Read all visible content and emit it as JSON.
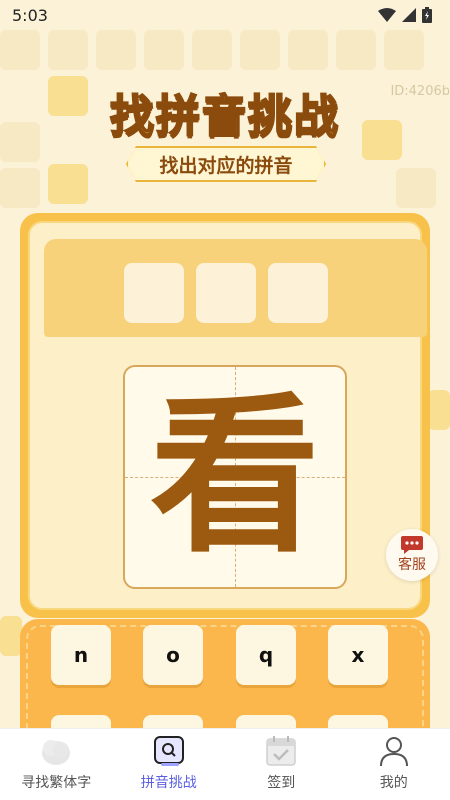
{
  "status_bar": {
    "time": "5:03"
  },
  "id_label": "ID:4206b",
  "title": "找拼音挑战",
  "subtitle": "找出对应的拼音",
  "question": {
    "character": "看",
    "answer_slots": 3
  },
  "customer_service": {
    "label": "客服",
    "icon": "chat-icon"
  },
  "keys": [
    "n",
    "o",
    "q",
    "x"
  ],
  "bottom_nav": {
    "items": [
      {
        "label": "寻找繁体字",
        "icon": "cloud-icon",
        "active": false
      },
      {
        "label": "拼音挑战",
        "icon": "search-card-icon",
        "active": true
      },
      {
        "label": "签到",
        "icon": "calendar-check-icon",
        "active": false
      },
      {
        "label": "我的",
        "icon": "user-icon",
        "active": false
      }
    ]
  },
  "colors": {
    "accent": "#f7c14a",
    "brown": "#9c5a10",
    "nav_active": "#5a5fe0"
  }
}
